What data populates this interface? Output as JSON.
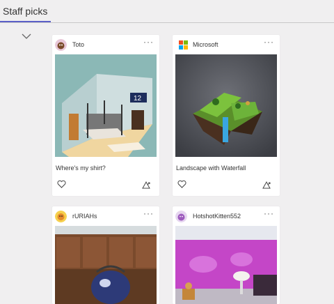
{
  "tab": {
    "label": "Staff picks",
    "accent": "#5b5fc7"
  },
  "cards": [
    {
      "author": "Toto",
      "title": "Where's my shirt?",
      "more": "···"
    },
    {
      "author": "Microsoft",
      "title": "Landscape with Waterfall",
      "more": "···"
    },
    {
      "author": "rURIAHs",
      "more": "···"
    },
    {
      "author": "HotshotKitten552",
      "more": "···"
    }
  ]
}
